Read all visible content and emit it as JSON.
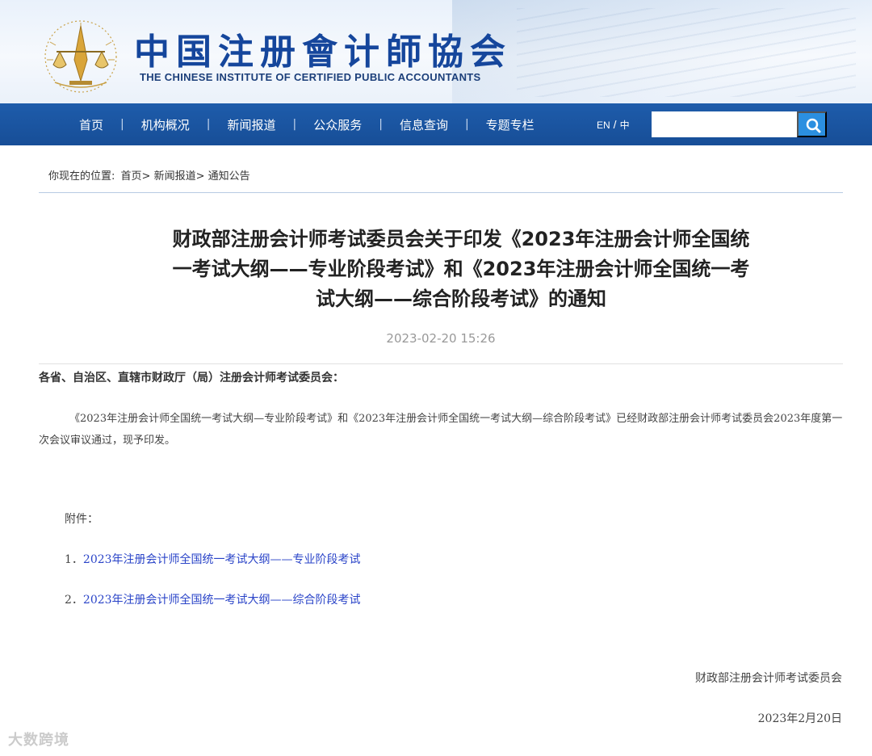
{
  "header": {
    "site_name_cn": "中国注册會计師協会",
    "site_name_en": "THE CHINESE INSTITUTE OF CERTIFIED PUBLIC ACCOUNTANTS"
  },
  "nav": {
    "items": [
      {
        "label": "首页"
      },
      {
        "label": "机构概况"
      },
      {
        "label": "新闻报道"
      },
      {
        "label": "公众服务"
      },
      {
        "label": "信息查询"
      },
      {
        "label": "专题专栏"
      }
    ],
    "separator": "|",
    "lang_en": "EN",
    "lang_slash": "/",
    "lang_cn": "中",
    "search_value": ""
  },
  "breadcrumb": {
    "prefix": "你现在的位置:",
    "items": [
      "首页>",
      "新闻报道>",
      "通知公告"
    ]
  },
  "article": {
    "title_lines": [
      "财政部注册会计师考试委员会关于印发《2023年注册会计师全国统",
      "一考试大纲——专业阶段考试》和《2023年注册会计师全国统一考",
      "试大纲——综合阶段考试》的通知"
    ],
    "date": "2023-02-20 15:26",
    "addressee": "各省、自治区、直辖市财政厅（局）注册会计师考试委员会：",
    "body": "《2023年注册会计师全国统一考试大纲—专业阶段考试》和《2023年注册会计师全国统一考试大纲—综合阶段考试》已经财政部注册会计师考试委员会2023年度第一次会议审议通过，现予印发。",
    "attachment_label": "附件：",
    "attachments": [
      {
        "num": "1．",
        "label": "2023年注册会计师全国统一考试大纲——专业阶段考试"
      },
      {
        "num": "2．",
        "label": "2023年注册会计师全国统一考试大纲——综合阶段考试"
      }
    ],
    "signature": "财政部注册会计师考试委员会",
    "signature_date": "2023年2月20日"
  },
  "watermark": "大数跨境",
  "colors": {
    "nav_bg": "#1e5cab",
    "brand_blue": "#15469c",
    "search_btn": "#2b8fe0",
    "link": "#2a44c8"
  },
  "icons": {
    "logo": "scales-of-justice-emblem",
    "search": "search-icon"
  }
}
